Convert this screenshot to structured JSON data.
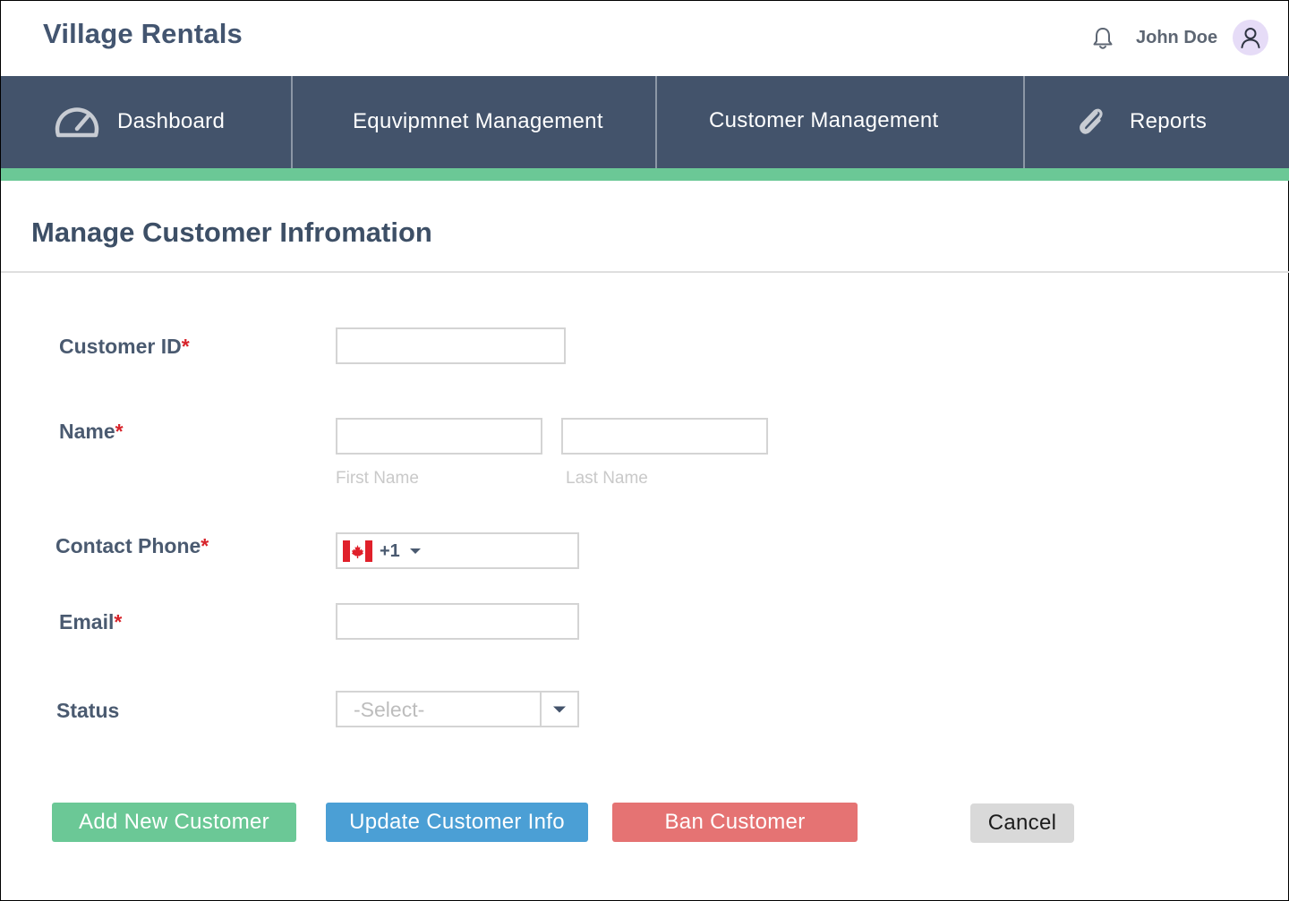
{
  "app": {
    "brand": "Village Rentals",
    "user_name": "John Doe"
  },
  "nav": {
    "items": [
      {
        "label": "Dashboard",
        "icon": "speedometer-icon"
      },
      {
        "label": "Equvipmnet Management",
        "icon": ""
      },
      {
        "label": "Customer Management",
        "icon": ""
      },
      {
        "label": "Reports",
        "icon": "paperclip-icon"
      }
    ]
  },
  "page": {
    "title": "Manage Customer Infromation"
  },
  "form": {
    "customer_id": {
      "label": "Customer ID",
      "required_mark": "*",
      "value": ""
    },
    "name": {
      "label": "Name",
      "required_mark": "*",
      "first_sub": "First Name",
      "last_sub": "Last Name",
      "first_value": "",
      "last_value": ""
    },
    "phone": {
      "label": "Contact Phone",
      "required_mark": "*",
      "country_code": "+1",
      "country_flag": "canada-flag-icon",
      "value": ""
    },
    "email": {
      "label": "Email",
      "required_mark": "*",
      "value": ""
    },
    "status": {
      "label": "Status",
      "selected": "-Select-"
    }
  },
  "buttons": {
    "add": "Add New Customer",
    "update": "Update Customer Info",
    "ban": "Ban Customer",
    "cancel": "Cancel"
  },
  "colors": {
    "nav_bg": "#43536b",
    "accent_green": "#6bc896",
    "update_blue": "#4b9fd5",
    "ban_red": "#e57373",
    "cancel_gray": "#d9d9d9",
    "required_red": "#d7232a"
  }
}
